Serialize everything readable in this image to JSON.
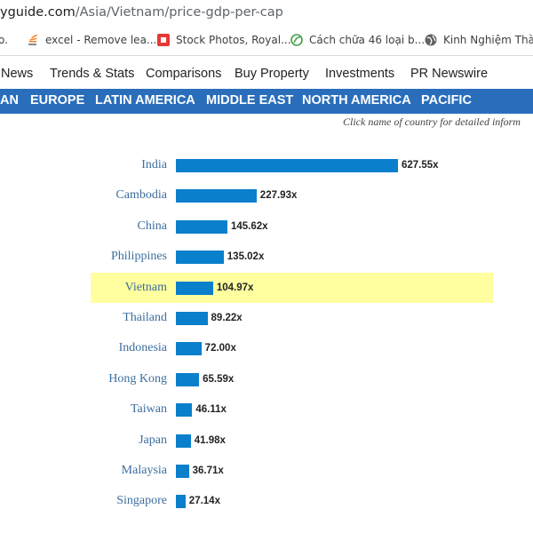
{
  "browser": {
    "url_host": "yguide.com",
    "url_path": "/Asia/Vietnam/price-gdp-per-cap",
    "bookmarks": [
      {
        "label": "o.",
        "icon": "bookmark-icon"
      },
      {
        "label": "excel - Remove lea...",
        "icon": "stack-overflow-icon"
      },
      {
        "label": "Stock Photos, Royal...",
        "icon": "stock-photo-icon"
      },
      {
        "label": "Cách chữa 46 loại b...",
        "icon": "leaf-icon"
      },
      {
        "label": "Kinh Nghiệm Thành...",
        "icon": "globe-icon"
      }
    ]
  },
  "site_nav": [
    "News",
    "Trends & Stats",
    "Comparisons",
    "Buy Property",
    "Investments",
    "PR Newswire"
  ],
  "region_nav": [
    "AN",
    "EUROPE",
    "LATIN AMERICA",
    "MIDDLE EAST",
    "NORTH AMERICA",
    "PACIFIC"
  ],
  "hint": "Click name of country for detailed inform",
  "colors": {
    "bar": "#0a7fcb",
    "highlight": "#ffffa0",
    "region_bar": "#2a6ebb",
    "label": "#3c6e9e"
  },
  "chart_data": {
    "type": "bar",
    "orientation": "horizontal",
    "categories": [
      "India",
      "Cambodia",
      "China",
      "Philippines",
      "Vietnam",
      "Thailand",
      "Indonesia",
      "Hong Kong",
      "Taiwan",
      "Japan",
      "Malaysia",
      "Singapore"
    ],
    "values": [
      627.55,
      227.93,
      145.62,
      135.02,
      104.97,
      89.22,
      72.0,
      65.59,
      46.11,
      41.98,
      36.71,
      27.14
    ],
    "value_labels": [
      "627.55x",
      "227.93x",
      "145.62x",
      "135.02x",
      "104.97x",
      "89.22x",
      "72.00x",
      "65.59x",
      "46.11x",
      "41.98x",
      "36.71x",
      "27.14x"
    ],
    "highlighted": "Vietnam"
  }
}
